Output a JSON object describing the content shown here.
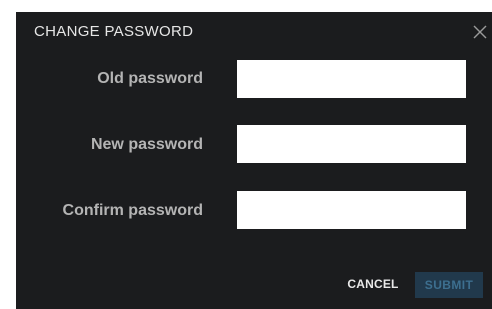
{
  "dialog": {
    "title": "CHANGE PASSWORD",
    "close_icon": "close-icon"
  },
  "form": {
    "old_password": {
      "label": "Old password",
      "value": ""
    },
    "new_password": {
      "label": "New password",
      "value": ""
    },
    "confirm_password": {
      "label": "Confirm password",
      "value": ""
    }
  },
  "actions": {
    "cancel_label": "CANCEL",
    "submit_label": "SUBMIT",
    "submit_enabled": false
  },
  "colors": {
    "background": "#1b1c1e",
    "label": "#b4b4b4",
    "submit_disabled_bg": "#21394c",
    "submit_disabled_text": "#3d6f8f"
  }
}
